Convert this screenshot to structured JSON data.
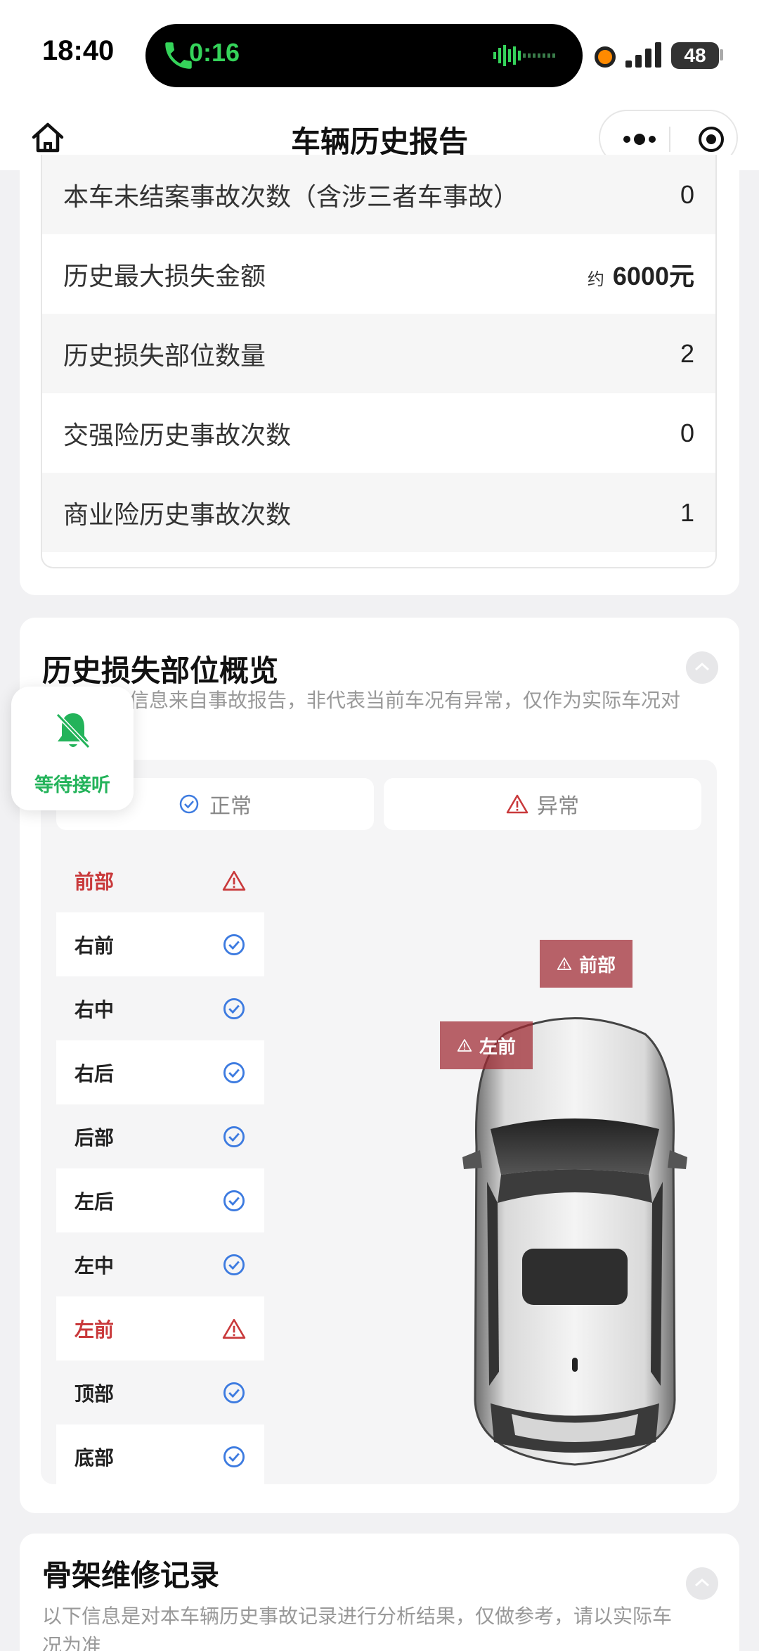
{
  "status_bar": {
    "time": "18:40",
    "call_duration": "0:16",
    "battery": "48"
  },
  "nav": {
    "title": "车辆历史报告"
  },
  "summary_table": {
    "rows": [
      {
        "label": "本车未结案事故次数（含涉三者车事故）",
        "value": "0"
      },
      {
        "label": "历史最大损失金额",
        "prefix": "约",
        "value": "6000元"
      },
      {
        "label": "历史损失部位数量",
        "value": "2"
      },
      {
        "label": "交强险历史事故次数",
        "value": "0"
      },
      {
        "label": "商业险历史事故次数",
        "value": "1"
      }
    ]
  },
  "damage_overview": {
    "title": "历史损失部位概览",
    "subtitle_line1": "信息来自事故报告，非代表当前车况有异常，仅作为实际车况对",
    "legend": {
      "normal": "正常",
      "abnormal": "异常"
    },
    "parts": [
      {
        "name": "前部",
        "status": "abnormal"
      },
      {
        "name": "右前",
        "status": "normal"
      },
      {
        "name": "右中",
        "status": "normal"
      },
      {
        "name": "右后",
        "status": "normal"
      },
      {
        "name": "后部",
        "status": "normal"
      },
      {
        "name": "左后",
        "status": "normal"
      },
      {
        "name": "左中",
        "status": "normal"
      },
      {
        "name": "左前",
        "status": "abnormal"
      },
      {
        "name": "顶部",
        "status": "normal"
      },
      {
        "name": "底部",
        "status": "normal"
      }
    ],
    "car_tags": {
      "front": "前部",
      "left_front": "左前"
    }
  },
  "frame_repair": {
    "title": "骨架维修记录",
    "subtitle_line1": "以下信息是对本车辆历史事故记录进行分析结果，仅做参考，请以实际车",
    "subtitle_line2": "况为准"
  },
  "floating_widget": {
    "label": "等待接听"
  },
  "colors": {
    "accent_red": "#c9393b",
    "accent_blue": "#3d7be0",
    "call_green": "#35d35a",
    "widget_green": "#23b35a"
  }
}
